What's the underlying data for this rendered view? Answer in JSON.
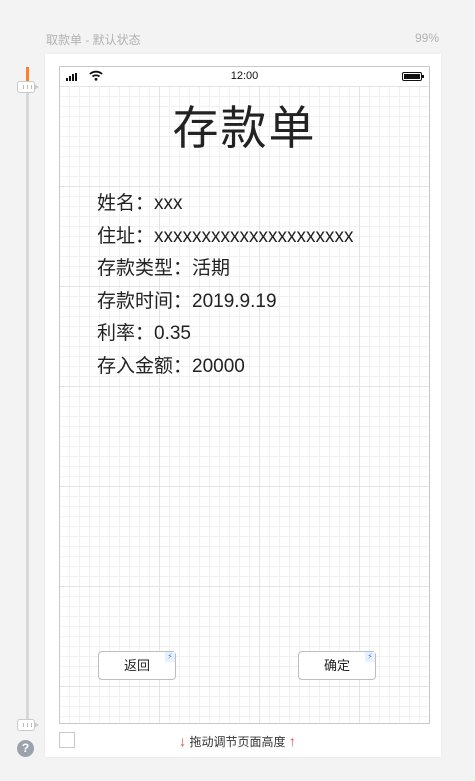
{
  "header": {
    "page_name": "取款单 - 默认状态",
    "zoom": "99%"
  },
  "statusbar": {
    "time": "12:00"
  },
  "form": {
    "title": "存款单",
    "fields": [
      "姓名：xxx",
      "住址：xxxxxxxxxxxxxxxxxxxxx",
      "存款类型：活期",
      "存款时间：2019.9.19",
      "利率：0.35",
      "存入金额：20000"
    ]
  },
  "buttons": {
    "back_label": "返回",
    "confirm_label": "确定",
    "flash_glyph": "⚡"
  },
  "footer": {
    "hint": "拖动调节页面高度",
    "arrow_down": "↓",
    "arrow_up": "↑"
  },
  "help": {
    "glyph": "?"
  },
  "colors": {
    "accent": "#ff7f2a",
    "arrow": "#e8453c"
  }
}
